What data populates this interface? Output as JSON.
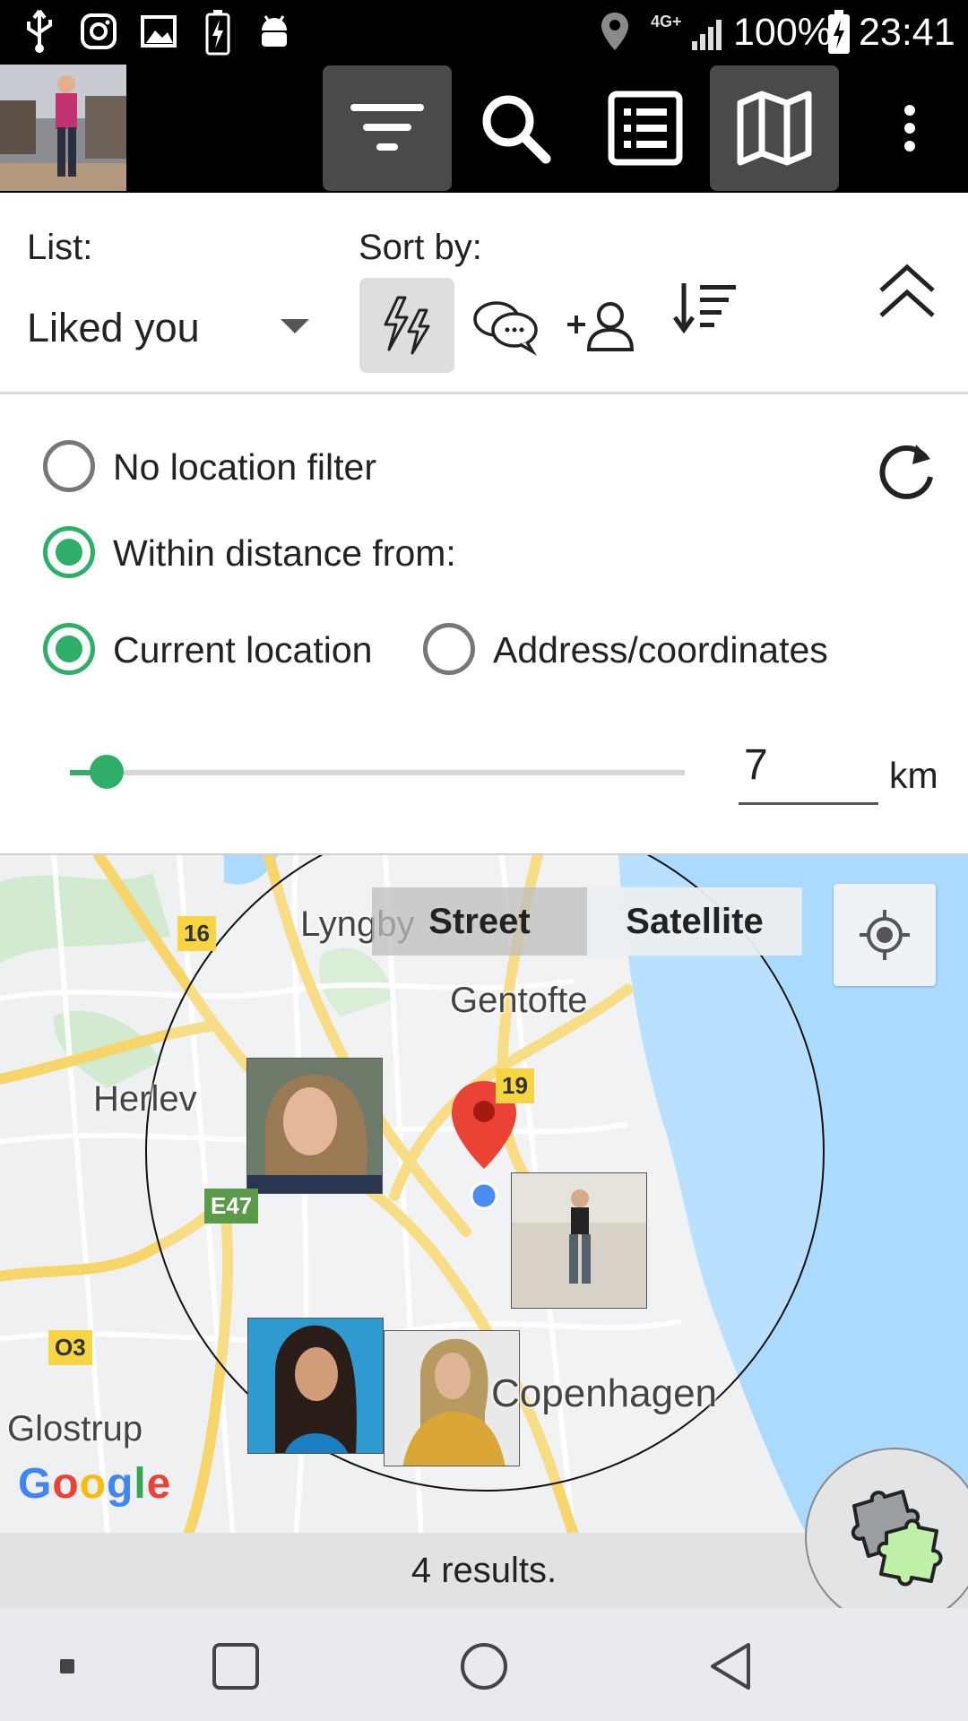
{
  "status_bar": {
    "battery": "100%",
    "time": "23:41",
    "network": "4G+",
    "icons": [
      "usb-icon",
      "instagram-icon",
      "image-icon",
      "battery-charging-icon",
      "android-debug-icon",
      "location-pin-icon",
      "signal-icon",
      "battery-icon"
    ]
  },
  "toolbar": {
    "icons": [
      "filter-icon",
      "search-icon",
      "list-view-icon",
      "map-view-icon",
      "more-vert-icon"
    ]
  },
  "filter": {
    "list_label": "List:",
    "list_value": "Liked you",
    "sort_label": "Sort by:",
    "sort_icons": [
      "activity-icon",
      "chat-icon",
      "add-person-icon",
      "sort-order-icon"
    ],
    "collapse_icon": "chevron-up-double-icon"
  },
  "location": {
    "no_filter_label": "No location filter",
    "within_label": "Within distance from:",
    "current_label": "Current location",
    "address_label": "Address/coordinates",
    "distance_value": "7",
    "distance_unit": "km",
    "slider_level_fraction": 0.06,
    "selected": "within",
    "origin": "current"
  },
  "map": {
    "toggle": {
      "street": "Street",
      "satellite": "Satellite",
      "selected": "Street"
    },
    "places": {
      "lyngby": "Lyngby",
      "gentofte": "Gentofte",
      "herlev": "Herlev",
      "glostrup": "Glostrup",
      "copenhagen": "Copenhagen"
    },
    "roads": {
      "r16": "16",
      "r19": "19",
      "e47": "E47",
      "o3": "O3"
    },
    "google": "Google",
    "colors": {
      "water": "#aadaff",
      "road": "#f6d66b",
      "accent": "#2fae67",
      "pin": "#ea4335"
    }
  },
  "results": "4 results."
}
